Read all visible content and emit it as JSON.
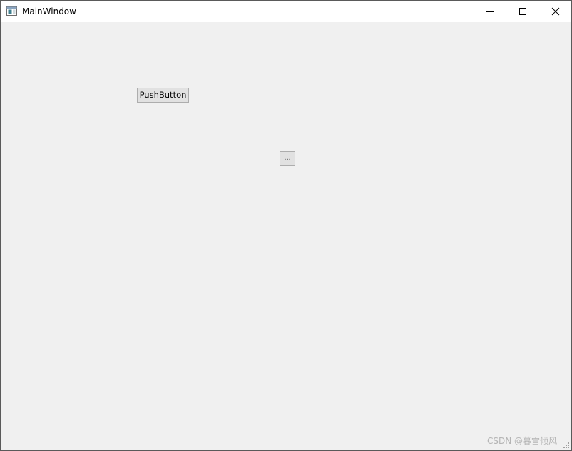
{
  "window": {
    "title": "MainWindow"
  },
  "caption": {
    "minimize_icon": "minimize-icon",
    "maximize_icon": "maximize-icon",
    "close_icon": "close-icon"
  },
  "main": {
    "push_button_label": "PushButton",
    "tool_button_label": "..."
  },
  "watermark": {
    "text": "CSDN @暮雪倾风"
  },
  "colors": {
    "client_bg": "#f0f0f0",
    "titlebar_bg": "#ffffff",
    "button_bg": "#e1e1e1",
    "button_border": "#adadad"
  }
}
